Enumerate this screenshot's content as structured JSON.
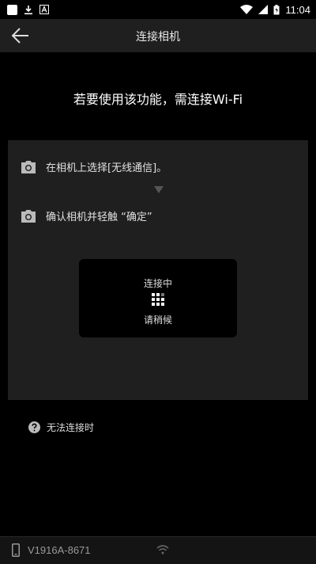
{
  "status_bar": {
    "time": "11:04",
    "icons": [
      "notification-square-icon",
      "download-icon",
      "a-icon",
      "wifi-icon",
      "signal-icon",
      "battery-icon"
    ]
  },
  "header": {
    "title": "连接相机",
    "back_icon": "arrow-left-icon"
  },
  "main": {
    "headline": "若要使用该功能，需连接Wi-Fi",
    "steps": [
      {
        "icon": "camera-icon",
        "text": "在相机上选择[无线通信]。"
      },
      {
        "icon": "camera-icon",
        "text": "确认相机并轻触 “确定”"
      }
    ],
    "connecting": {
      "title": "连接中",
      "wait": "请稍候"
    },
    "help_link": "无法连接时"
  },
  "bottom_bar": {
    "device_name": "V1916A-8671",
    "device_icon": "phone-icon",
    "wifi_icon": "wifi-icon"
  },
  "colors": {
    "background": "#000000",
    "panel": "#1f1f1f",
    "text": "#ffffff",
    "muted": "#999999"
  }
}
